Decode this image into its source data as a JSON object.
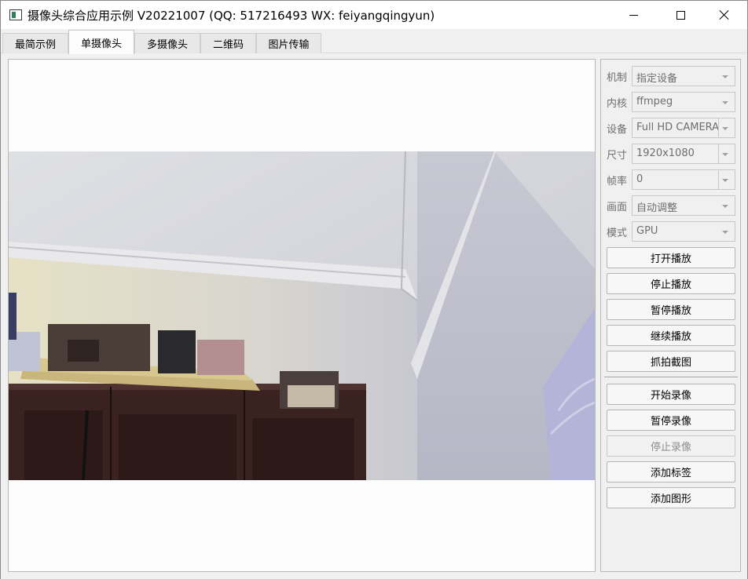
{
  "window": {
    "title": "摄像头综合应用示例 V20221007 (QQ: 517216493 WX: feiyangqingyun)"
  },
  "tabs": [
    {
      "label": "最简示例",
      "active": false
    },
    {
      "label": "单摄像头",
      "active": true
    },
    {
      "label": "多摄像头",
      "active": false
    },
    {
      "label": "二维码",
      "active": false
    },
    {
      "label": "图片传输",
      "active": false
    }
  ],
  "settings": {
    "mechanism": {
      "label": "机制",
      "value": "指定设备"
    },
    "core": {
      "label": "内核",
      "value": "ffmpeg"
    },
    "device": {
      "label": "设备",
      "value": "Full HD CAMERA"
    },
    "size": {
      "label": "尺寸",
      "value": "1920x1080"
    },
    "fps": {
      "label": "帧率",
      "value": "0"
    },
    "picture": {
      "label": "画面",
      "value": "自动调整"
    },
    "mode": {
      "label": "模式",
      "value": "GPU"
    }
  },
  "buttons": {
    "open_play": "打开播放",
    "stop_play": "停止播放",
    "pause_play": "暂停播放",
    "resume_play": "继续播放",
    "snapshot": "抓拍截图",
    "start_record": "开始录像",
    "pause_record": "暂停录像",
    "stop_record": "停止录像",
    "add_label": "添加标签",
    "add_shape": "添加图形"
  },
  "icons": {
    "app": "app-window-icon",
    "minimize": "minimize-icon",
    "maximize": "maximize-icon",
    "close": "close-icon"
  }
}
